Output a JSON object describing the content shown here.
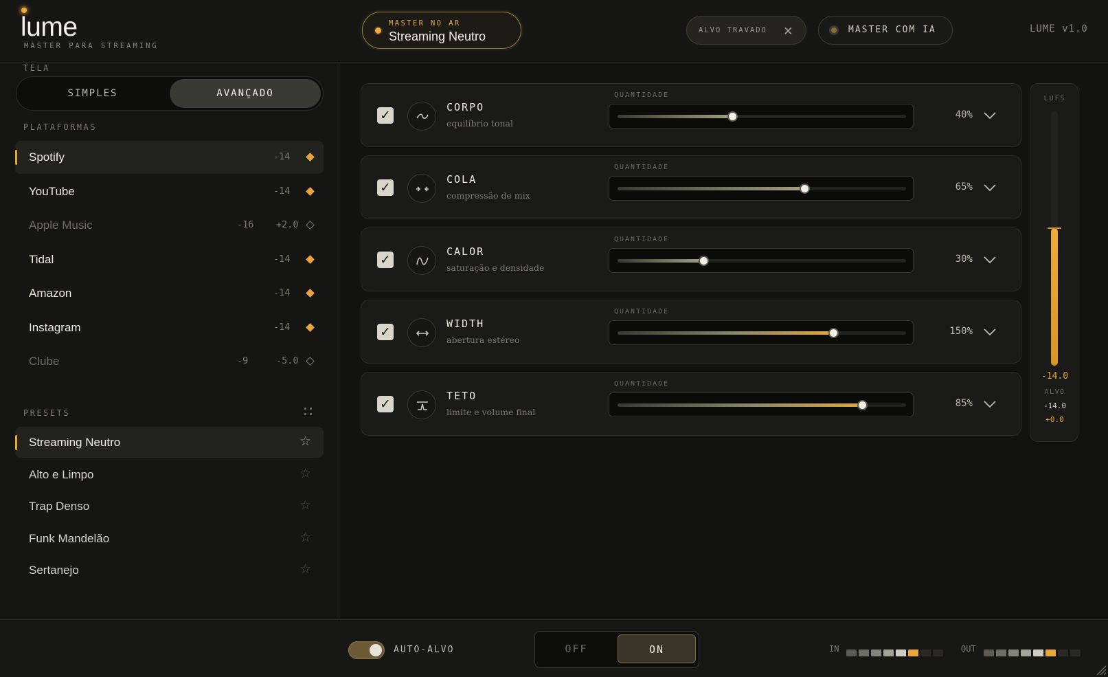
{
  "header": {
    "logo": "lume",
    "logo_sub": "MASTER PARA STREAMING",
    "now_playing_label": "MASTER NO AR",
    "now_playing_value": "Streaming Neutro",
    "target_locked_label": "ALVO TRAVADO",
    "ai_master_label": "MASTER COM IA",
    "version": "LUME v1.0"
  },
  "sidebar": {
    "screen_label": "TELA",
    "modes": {
      "simple": "SIMPLES",
      "advanced": "AVANÇADO",
      "selected": "advanced"
    },
    "platforms_label": "PLATAFORMAS",
    "platforms": [
      {
        "name": "Spotify",
        "lufs": "-14",
        "offset": "",
        "filled": true,
        "active": true
      },
      {
        "name": "YouTube",
        "lufs": "-14",
        "offset": "",
        "filled": true
      },
      {
        "name": "Apple Music",
        "lufs": "-16",
        "offset": "+2.0",
        "filled": false,
        "dim": true
      },
      {
        "name": "Tidal",
        "lufs": "-14",
        "offset": "",
        "filled": true
      },
      {
        "name": "Amazon",
        "lufs": "-14",
        "offset": "",
        "filled": true
      },
      {
        "name": "Instagram",
        "lufs": "-14",
        "offset": "",
        "filled": true
      },
      {
        "name": "Clube",
        "lufs": "-9",
        "offset": "-5.0",
        "filled": false,
        "dim": true
      }
    ],
    "presets_label": "PRESETS",
    "presets": [
      {
        "name": "Streaming Neutro",
        "active": true
      },
      {
        "name": "Alto e Limpo"
      },
      {
        "name": "Trap Denso"
      },
      {
        "name": "Funk Mandelão"
      },
      {
        "name": "Sertanejo"
      }
    ]
  },
  "modules": [
    {
      "title": "CORPO",
      "subtitle": "equilíbrio tonal",
      "amount_label": "QUANTIDADE",
      "value": "40%",
      "level": 0.4,
      "icon": "tilde-icon",
      "checked": true
    },
    {
      "title": "COLA",
      "subtitle": "compressão de mix",
      "amount_label": "QUANTIDADE",
      "value": "65%",
      "level": 0.65,
      "icon": "compress-icon",
      "checked": true
    },
    {
      "title": "CALOR",
      "subtitle": "saturação e densidade",
      "amount_label": "QUANTIDADE",
      "value": "30%",
      "level": 0.3,
      "icon": "wave-icon",
      "checked": true
    },
    {
      "title": "WIDTH",
      "subtitle": "abertura estéreo",
      "amount_label": "QUANTIDADE",
      "value": "150%",
      "level": 0.75,
      "icon": "stereo-width-icon",
      "checked": true
    },
    {
      "title": "TETO",
      "subtitle": "limite e volume final",
      "amount_label": "QUANTIDADE",
      "value": "85%",
      "level": 0.85,
      "icon": "limiter-icon",
      "checked": true
    }
  ],
  "meter": {
    "label": "LUFS",
    "value": "-14.0",
    "level": 0.54,
    "target_label": "ALVO",
    "target_value": "-14.0",
    "delta": "+0.0"
  },
  "footer": {
    "auto_target_label": "AUTO-ALVO",
    "auto_target_on": true,
    "off_label": "OFF",
    "on_label": "ON",
    "in_label": "IN",
    "out_label": "OUT",
    "in_segments": [
      "#5c5a53",
      "#6f6d65",
      "#85837a",
      "#a5a298",
      "#cfcbc1",
      "#e8a637",
      "#2a2925",
      "#2a2925"
    ],
    "out_segments": [
      "#5c5a53",
      "#6f6d65",
      "#85837a",
      "#a5a298",
      "#cfcbc1",
      "#e8a637",
      "#2a2925",
      "#2a2925"
    ]
  },
  "colors": {
    "accent": "#e8a637",
    "bg": "#141412",
    "panel": "#1a1a18"
  }
}
